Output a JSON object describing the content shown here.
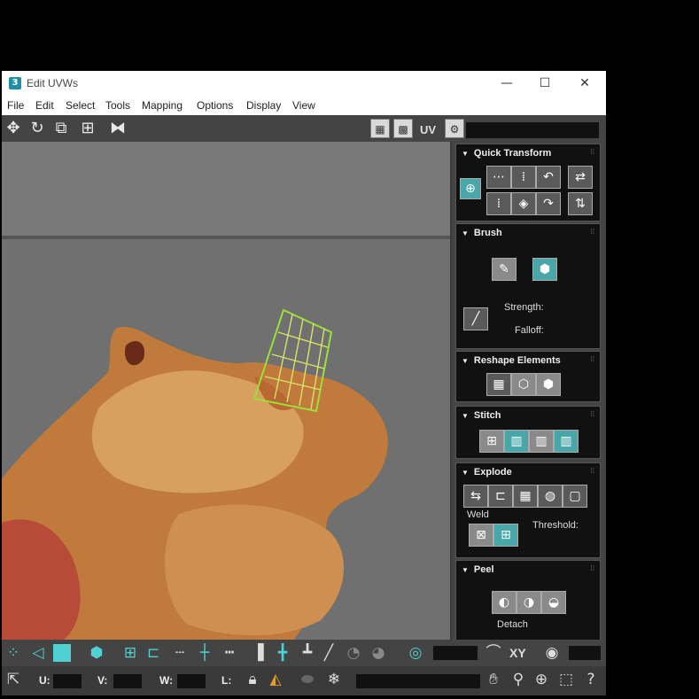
{
  "window": {
    "title": "Edit UVWs",
    "app_icon": "3",
    "minimize": "—",
    "maximize": "☐",
    "close": "✕"
  },
  "menu": [
    "File",
    "Edit",
    "Select",
    "Tools",
    "Mapping",
    "Options",
    "Display",
    "View"
  ],
  "toolbar": {
    "uv_label": "UV"
  },
  "panels": {
    "quick_transform": "Quick Transform",
    "brush": {
      "title": "Brush",
      "strength": "Strength:",
      "falloff": "Falloff:"
    },
    "reshape": "Reshape Elements",
    "stitch": "Stitch",
    "explode": {
      "title": "Explode",
      "weld": "Weld",
      "threshold": "Threshold:"
    },
    "peel": {
      "title": "Peel",
      "detach": "Detach"
    }
  },
  "bottom": {
    "xy": "XY",
    "u": "U:",
    "v": "V:",
    "w": "W:",
    "l": "L:"
  }
}
